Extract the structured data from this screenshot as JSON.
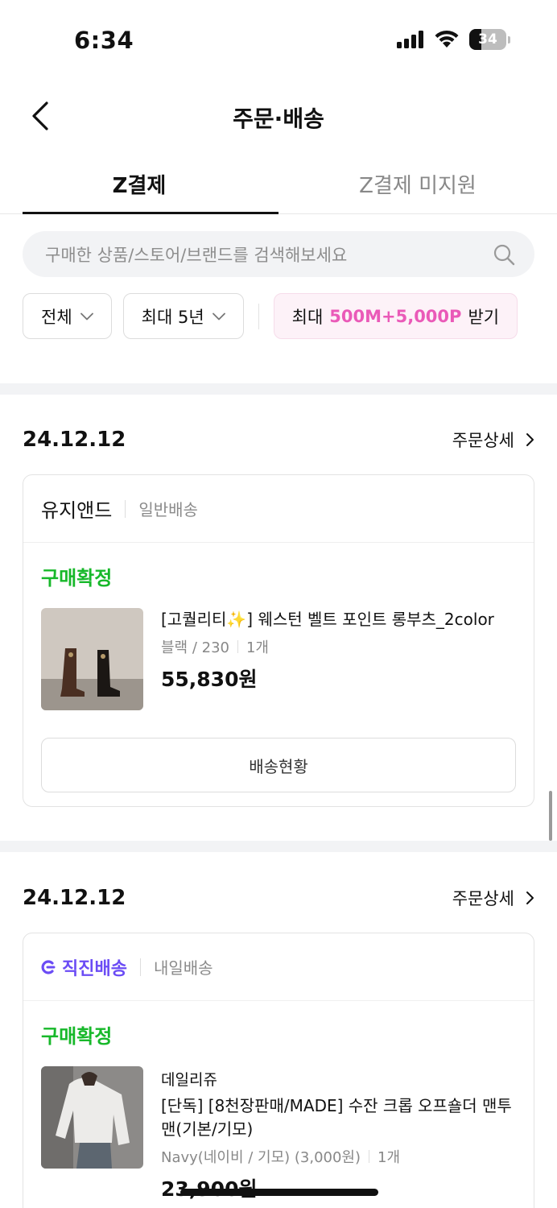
{
  "status_bar": {
    "time": "6:34",
    "battery": "34"
  },
  "nav": {
    "title": "주문·배송"
  },
  "tabs": [
    {
      "label": "Z결제",
      "active": true
    },
    {
      "label": "Z결제 미지원",
      "active": false
    }
  ],
  "search": {
    "placeholder": "구매한 상품/스토어/브랜드를 검색해보세요"
  },
  "filters": {
    "status": "전체",
    "period": "최대 5년",
    "promo_prefix": "최대",
    "promo_highlight": "500M+5,000P",
    "promo_suffix": "받기"
  },
  "orders": [
    {
      "date": "24.12.12",
      "detail_label": "주문상세",
      "store": "유지앤드",
      "shipping": "일반배송",
      "status": "구매확정",
      "product_name": "[고퀄리티✨] 웨스턴 벨트 포인트 롱부츠_2color",
      "option": "블랙 / 230",
      "quantity": "1개",
      "price": "55,830원",
      "action": "배송현황"
    },
    {
      "date": "24.12.12",
      "detail_label": "주문상세",
      "store": "직진배송",
      "shipping": "내일배송",
      "status": "구매확정",
      "brand": "데일리쥬",
      "product_name": "[단독] [8천장판매/MADE] 수잔 크롭 오프숄더 맨투맨(기본/기모)",
      "option": "Navy(네이비 / 기모)  (3,000원)",
      "quantity": "1개",
      "price": "23,900원"
    }
  ],
  "colors": {
    "confirmed": "#17b82a",
    "promo": "#ea5ab8",
    "direct": "#6b4cf5"
  }
}
